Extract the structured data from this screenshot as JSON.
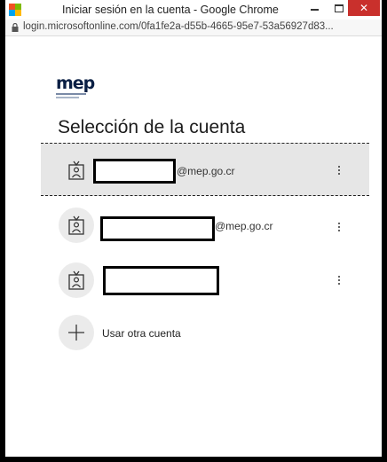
{
  "window": {
    "title": "Iniciar sesión en la cuenta - Google Chrome",
    "minimize_glyph": "–",
    "maximize_glyph": "□",
    "close_glyph": "✕"
  },
  "address_bar": {
    "url": "login.microsoftonline.com/0fa1fe2a-d55b-4665-95e7-53a56927d83..."
  },
  "brand": {
    "logo_text": "mep"
  },
  "page": {
    "heading": "Selección de la cuenta"
  },
  "accounts": [
    {
      "name_redacted": true,
      "domain": "@mep.go.cr",
      "selected": true
    },
    {
      "name_redacted": true,
      "domain": "@mep.go.cr",
      "selected": false
    },
    {
      "name_redacted": true,
      "domain": "",
      "selected": false
    }
  ],
  "add_account": {
    "label": "Usar otra cuenta"
  },
  "colors": {
    "selected_row_bg": "#e6e6e6",
    "avatar_bg": "#ebebeb",
    "close_button": "#c9302c",
    "brand_navy": "#0a1f44"
  }
}
